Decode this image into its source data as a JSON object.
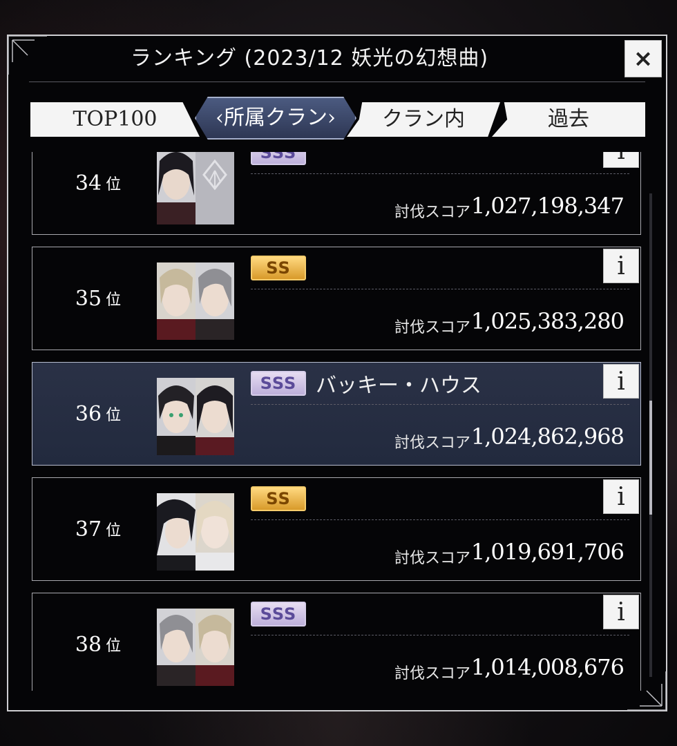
{
  "dialog": {
    "title": "ランキング (2023/12 妖光の幻想曲)",
    "close_label": "×"
  },
  "tabs": [
    {
      "label": "TOP100"
    },
    {
      "label": "‹所属クラン›"
    },
    {
      "label": "クラン内"
    },
    {
      "label": "過去"
    }
  ],
  "rows": [
    {
      "rank": "34",
      "unit": "位",
      "grade": "SSS",
      "clan_name": "",
      "score_label": "討伐スコア",
      "score": "1,027,198,347",
      "info": "i"
    },
    {
      "rank": "35",
      "unit": "位",
      "grade": "SS",
      "clan_name": "",
      "score_label": "討伐スコア",
      "score": "1,025,383,280",
      "info": "i"
    },
    {
      "rank": "36",
      "unit": "位",
      "grade": "SSS",
      "clan_name": "バッキー・ハウス",
      "score_label": "討伐スコア",
      "score": "1,024,862,968",
      "info": "i"
    },
    {
      "rank": "37",
      "unit": "位",
      "grade": "SS",
      "clan_name": "",
      "score_label": "討伐スコア",
      "score": "1,019,691,706",
      "info": "i"
    },
    {
      "rank": "38",
      "unit": "位",
      "grade": "SSS",
      "clan_name": "",
      "score_label": "討伐スコア",
      "score": "1,014,008,676",
      "info": "i"
    }
  ],
  "colors": {
    "sss_badge": "#bdb0da",
    "ss_badge": "#d89a2a",
    "highlight_row": "#2a3146",
    "active_tab": "#3a4668"
  }
}
